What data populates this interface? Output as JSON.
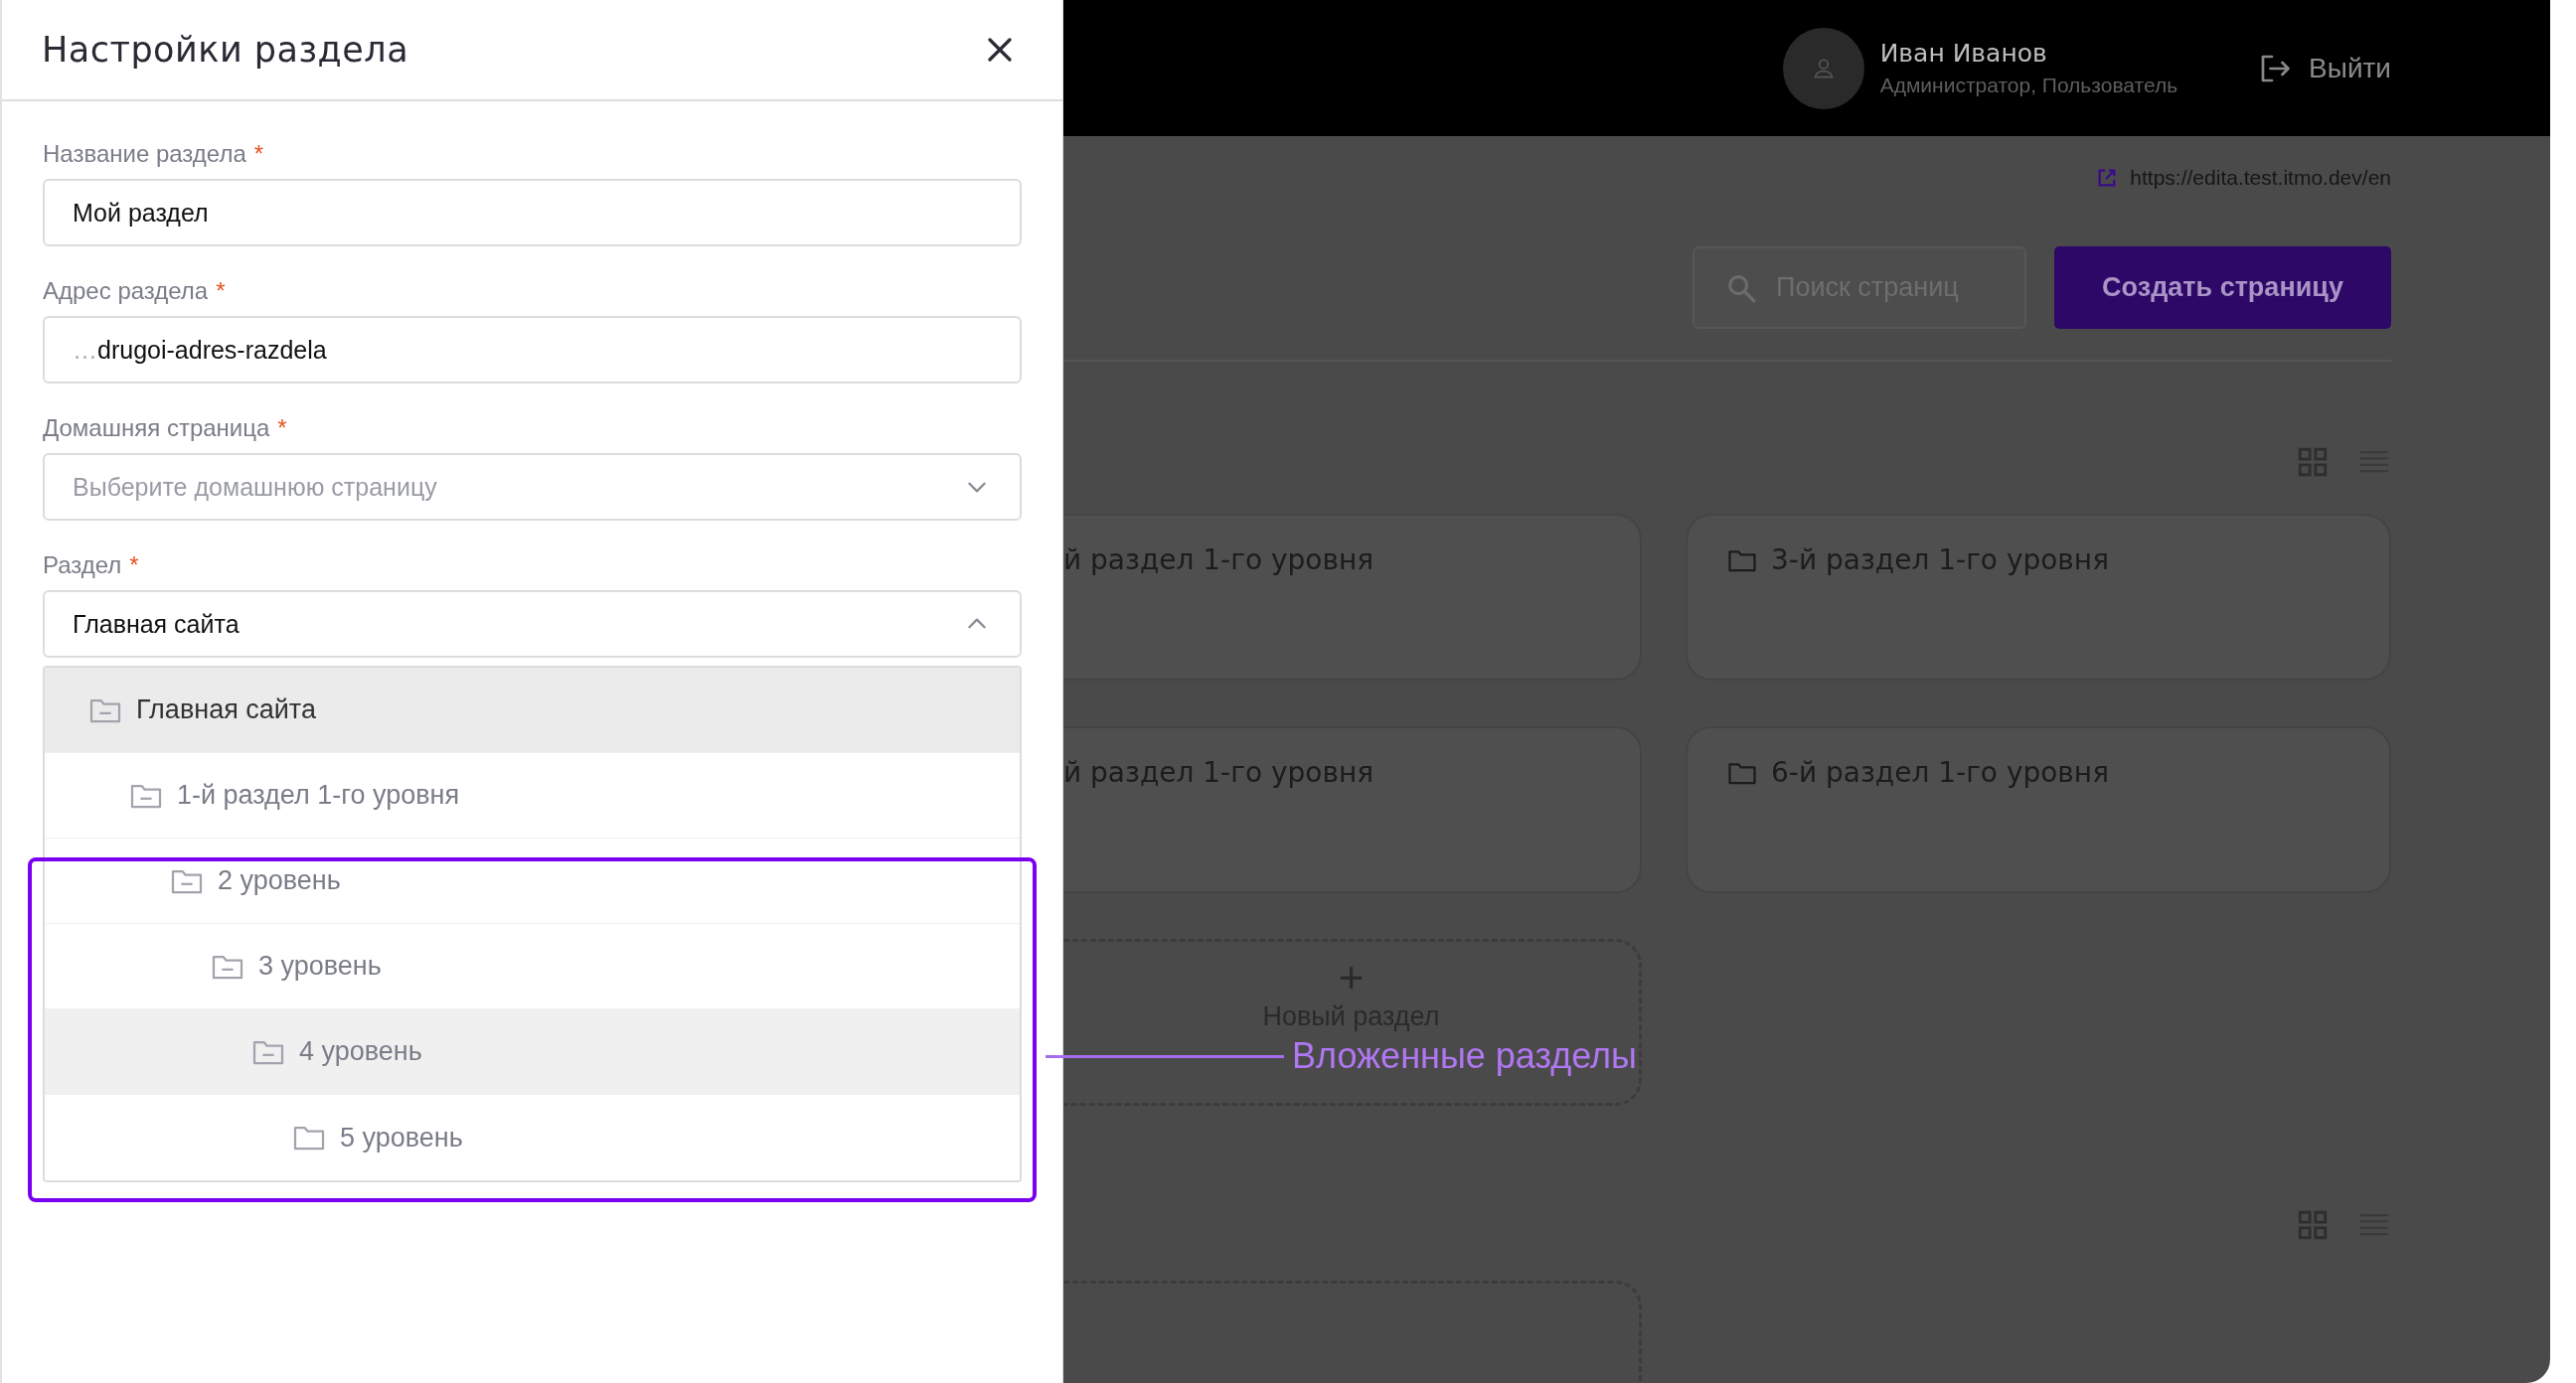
{
  "drawer": {
    "title": "Настройки раздела",
    "fields": [
      {
        "kind": "input",
        "label": "Название раздела",
        "required_mark": "*",
        "value": "Мой раздел"
      },
      {
        "kind": "input",
        "label": "Адрес раздела",
        "required_mark": "*",
        "prefix": "…",
        "value": "drugoi-adres-razdela"
      },
      {
        "kind": "select",
        "label": "Домашняя страница",
        "required_mark": "*",
        "placeholder": "Выберите домашнюю страницу",
        "expanded": false
      },
      {
        "kind": "select",
        "label": "Раздел",
        "required_mark": "*",
        "value": "Главная сайта",
        "expanded": true
      }
    ],
    "tree": [
      {
        "label": "Главная сайта",
        "selected": true,
        "hovered": false,
        "expanded": true,
        "children": [
          {
            "label": "1-й раздел 1-го уровня",
            "selected": false,
            "hovered": false,
            "expanded": true,
            "children": [
              {
                "label": "2 уровень",
                "selected": false,
                "hovered": false,
                "expanded": true,
                "children": [
                  {
                    "label": "3 уровень",
                    "selected": false,
                    "hovered": false,
                    "expanded": true,
                    "children": [
                      {
                        "label": "4 уровень",
                        "selected": false,
                        "hovered": true,
                        "expanded": true,
                        "children": [
                          {
                            "label": "5 уровень",
                            "selected": false,
                            "hovered": false,
                            "expanded": false
                          }
                        ]
                      }
                    ]
                  }
                ]
              }
            ]
          }
        ]
      }
    ]
  },
  "annotation": {
    "label": "Вложенные разделы"
  },
  "header": {
    "user_name": "Иван Иванов",
    "user_roles": "Администратор, Пользователь",
    "logout": "Выйти"
  },
  "site_link": "https://edita.test.itmo.dev/en",
  "search": {
    "placeholder": "Поиск страниц"
  },
  "create_button": "Создать страницу",
  "sections": [
    {
      "title": "й раздел 1-го уровня",
      "kind": "cut"
    },
    {
      "title": "3-й раздел 1-го уровня",
      "kind": "folder"
    },
    {
      "title": "й раздел 1-го уровня",
      "kind": "cut"
    },
    {
      "title": "6-й раздел 1-го уровня",
      "kind": "folder"
    },
    {
      "title": "Новый раздел",
      "symbol": "+",
      "kind": "new"
    }
  ]
}
